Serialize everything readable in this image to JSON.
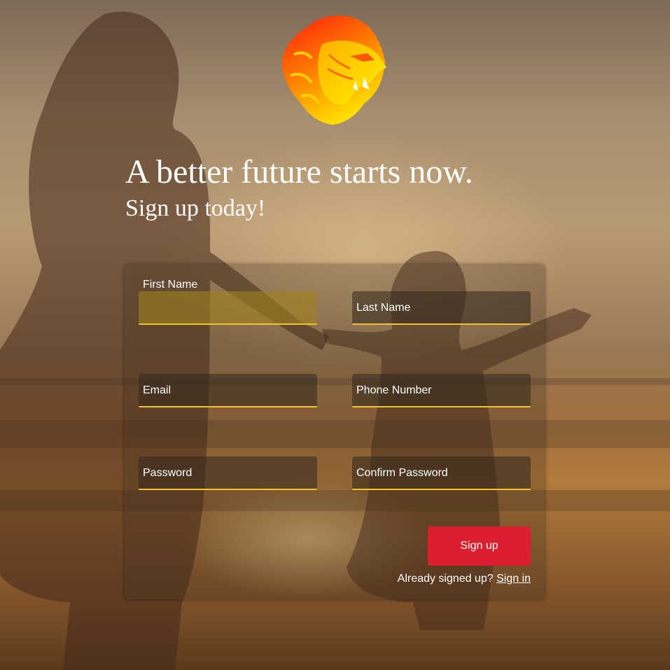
{
  "brand": {
    "logo": "lion-head-logo",
    "colors": {
      "logo_top": "#ff2a10",
      "logo_mid": "#ff8a00",
      "logo_bottom": "#ffe800"
    }
  },
  "hero": {
    "headline": "A better future starts now.",
    "subheadline": "Sign up today!"
  },
  "form": {
    "fields": {
      "first_name": {
        "label": "First Name",
        "value": ""
      },
      "last_name": {
        "label": "Last Name",
        "value": ""
      },
      "email": {
        "label": "Email",
        "value": ""
      },
      "phone": {
        "label": "Phone Number",
        "value": ""
      },
      "password": {
        "label": "Password",
        "value": ""
      },
      "confirm_password": {
        "label": "Confirm Password",
        "value": ""
      }
    },
    "submit_label": "Sign up",
    "signin_prompt": "Already signed up?",
    "signin_link": "Sign in"
  },
  "colors": {
    "field_underline": "#f2c230",
    "button": "#dc1f2e",
    "text": "#ffffff"
  }
}
